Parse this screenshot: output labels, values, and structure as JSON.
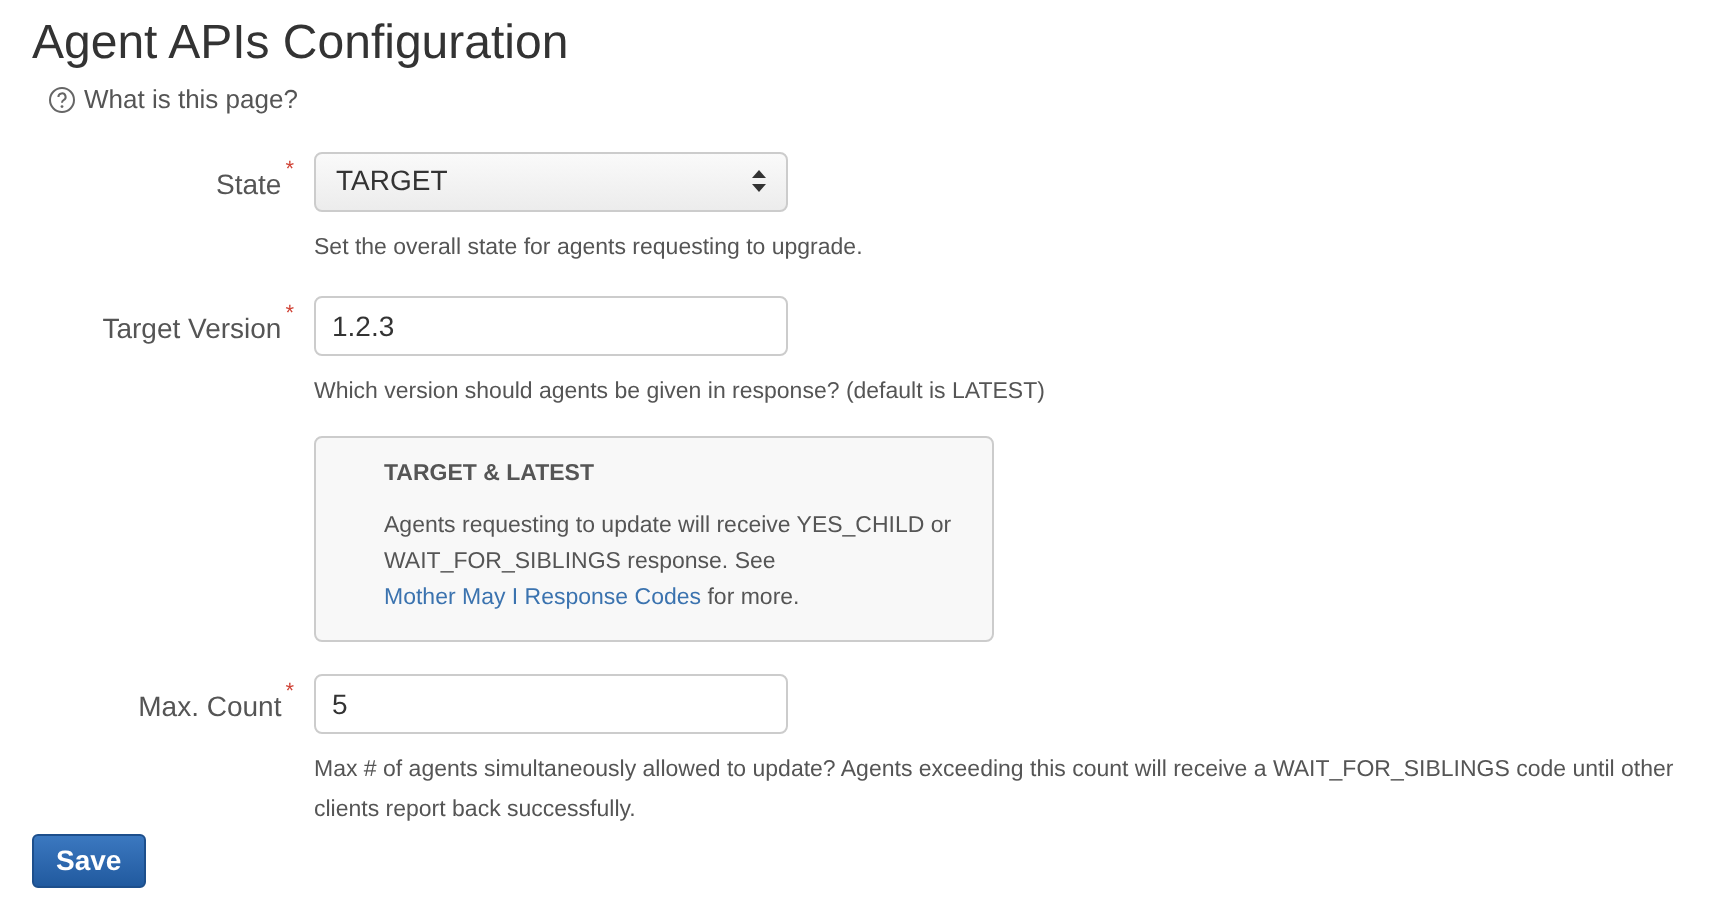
{
  "title": "Agent APIs Configuration",
  "help_link": "What is this page?",
  "fields": [
    {
      "kind": "select",
      "label": "State",
      "required_mark": "*",
      "value": "TARGET",
      "description": "Set the overall state for agents requesting to upgrade."
    },
    {
      "kind": "text",
      "label": "Target Version",
      "required_mark": "*",
      "value": "1.2.3",
      "description": "Which version should agents be given in response? (default is LATEST)",
      "info": {
        "heading": "TARGET & LATEST",
        "text_before": "Agents requesting to update will receive YES_CHILD or WAIT_FOR_SIBLINGS response. See",
        "link": "Mother May I Response Codes",
        "text_after": "for more."
      }
    },
    {
      "kind": "text",
      "label": "Max. Count",
      "required_mark": "*",
      "value": "5",
      "description": "Max # of agents simultaneously allowed to update? Agents exceeding this count will receive a WAIT_FOR_SIBLINGS code until other clients report back successfully."
    }
  ],
  "save_button": "Save"
}
